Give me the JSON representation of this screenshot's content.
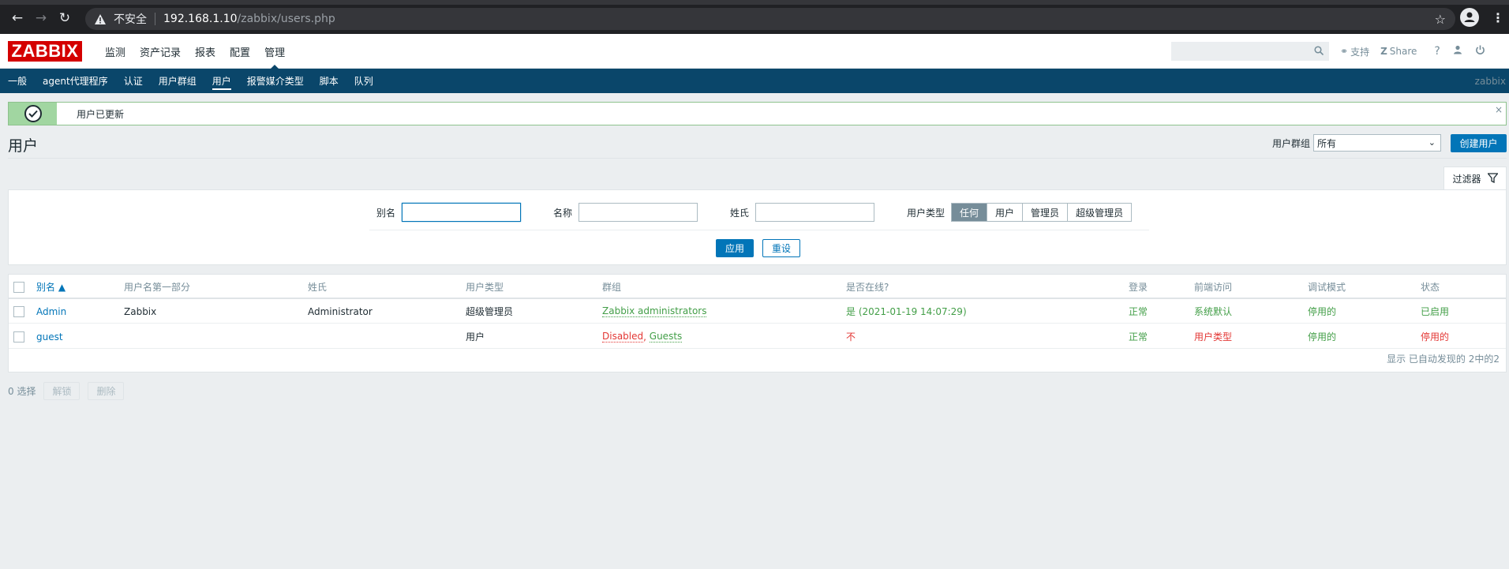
{
  "browser": {
    "security_label": "不安全",
    "url_host": "192.168.1.10",
    "url_path": "/zabbix/users.php"
  },
  "header": {
    "logo": "ZABBIX",
    "menu": [
      "监测",
      "资产记录",
      "报表",
      "配置",
      "管理"
    ],
    "active_menu": "管理",
    "support_label": "支持",
    "share_label": "Share",
    "help_label": "?"
  },
  "subnav": {
    "items": [
      "一般",
      "agent代理程序",
      "认证",
      "用户群组",
      "用户",
      "报警媒介类型",
      "脚本",
      "队列"
    ],
    "active": "用户",
    "server_name": "zabbix"
  },
  "message": {
    "text": "用户已更新",
    "close": "×"
  },
  "page": {
    "title": "用户",
    "group_filter_label": "用户群组",
    "group_filter_value": "所有",
    "create_button": "创建用户"
  },
  "filter": {
    "tab_label": "过滤器",
    "alias_label": "别名",
    "name_label": "名称",
    "surname_label": "姓氏",
    "type_label": "用户类型",
    "type_options": [
      "任何",
      "用户",
      "管理员",
      "超级管理员"
    ],
    "type_selected": "任何",
    "apply_button": "应用",
    "reset_button": "重设"
  },
  "table": {
    "headers": [
      "别名 ▲",
      "用户名第一部分",
      "姓氏",
      "用户类型",
      "群组",
      "是否在线?",
      "登录",
      "前端访问",
      "调试模式",
      "状态"
    ],
    "rows": [
      {
        "alias": "Admin",
        "name": "Zabbix",
        "surname": "Administrator",
        "type": "超级管理员",
        "groups": [
          {
            "text": "Zabbix administrators",
            "color": "green"
          }
        ],
        "online": "是 (2021-01-19 14:07:29)",
        "online_color": "green",
        "login": "正常",
        "login_color": "green",
        "frontend": "系统默认",
        "frontend_color": "green",
        "debug": "停用的",
        "debug_color": "green",
        "status": "已启用",
        "status_color": "green"
      },
      {
        "alias": "guest",
        "name": "",
        "surname": "",
        "type": "用户",
        "groups": [
          {
            "text": "Disabled",
            "color": "red"
          },
          {
            "text": "Guests",
            "color": "green"
          }
        ],
        "online": "不",
        "online_color": "red",
        "login": "正常",
        "login_color": "green",
        "frontend": "用户类型",
        "frontend_color": "red",
        "debug": "停用的",
        "debug_color": "green",
        "status": "停用的",
        "status_color": "red"
      }
    ],
    "footer": "显示 已自动发现的 2中的2"
  },
  "bottom": {
    "selected": "0 选择",
    "unblock_button": "解锁",
    "delete_button": "删除"
  },
  "colors": {
    "nav_bg": "#0a466a",
    "link": "#0275b8",
    "green": "#429e47",
    "red": "#e33734",
    "logo_red": "#d40000"
  }
}
